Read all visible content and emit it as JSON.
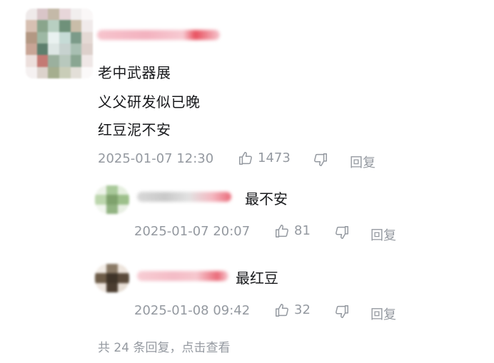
{
  "comment": {
    "lines": [
      "老中武器展",
      "义父研发似已晚",
      "红豆泥不安"
    ],
    "time": "2025-01-07 12:30",
    "likes": "1473",
    "reply_label": "回复"
  },
  "replies": [
    {
      "text": "最不安",
      "time": "2025-01-07 20:07",
      "likes": "81",
      "reply_label": "回复"
    },
    {
      "text": "最红豆",
      "time": "2025-01-08 09:42",
      "likes": "32",
      "reply_label": "回复"
    }
  ],
  "footer": {
    "more_replies": "共 24 条回复，点击查看"
  },
  "colors": {
    "text": "#18191c",
    "meta": "#9499a0",
    "name_blur": "#f2a6b4"
  },
  "icons": {
    "like": "thumb-up-icon",
    "dislike": "thumb-down-icon"
  }
}
